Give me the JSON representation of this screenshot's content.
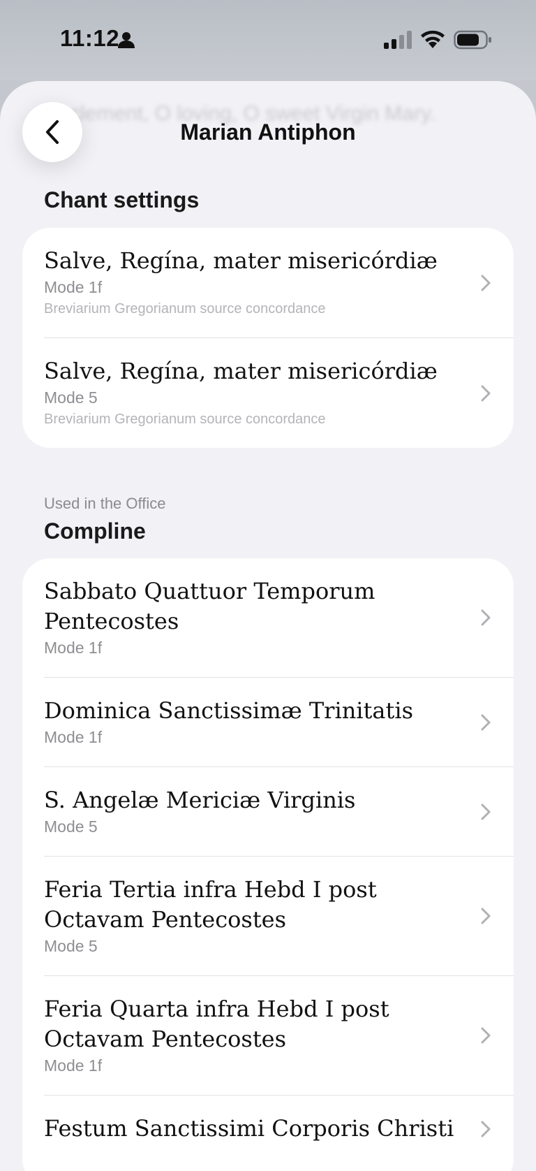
{
  "status": {
    "time": "11:12"
  },
  "header": {
    "title": "Marian Antiphon",
    "ghost_text": "clement, O loving, O sweet Virgin Mary."
  },
  "chant_settings": {
    "heading": "Chant settings",
    "items": [
      {
        "title": "Salve, Regína, mater misericórdiæ",
        "mode": "Mode 1f",
        "source": "Breviarium Gregorianum source concordance"
      },
      {
        "title": "Salve, Regína, mater misericórdiæ",
        "mode": "Mode 5",
        "source": "Breviarium Gregorianum source concordance"
      }
    ]
  },
  "office": {
    "caption": "Used in the Office",
    "heading": "Compline",
    "items": [
      {
        "title": "Sabbato Quattuor Temporum Pentecostes",
        "mode": "Mode 1f"
      },
      {
        "title": "Dominica Sanctissimæ Trinitatis",
        "mode": "Mode 1f"
      },
      {
        "title": "S. Angelæ Mericiæ Virginis",
        "mode": "Mode 5"
      },
      {
        "title": "Feria Tertia infra Hebd I post Octavam Pentecostes",
        "mode": "Mode 5"
      },
      {
        "title": "Feria Quarta infra Hebd I post Octavam Pentecostes",
        "mode": "Mode 1f"
      },
      {
        "title": "Festum Sanctissimi Corporis Christi",
        "mode": ""
      }
    ]
  },
  "colors": {
    "sheet_background": "#f1f1f6",
    "card_background": "#ffffff",
    "secondary_text": "#8e8e93"
  }
}
